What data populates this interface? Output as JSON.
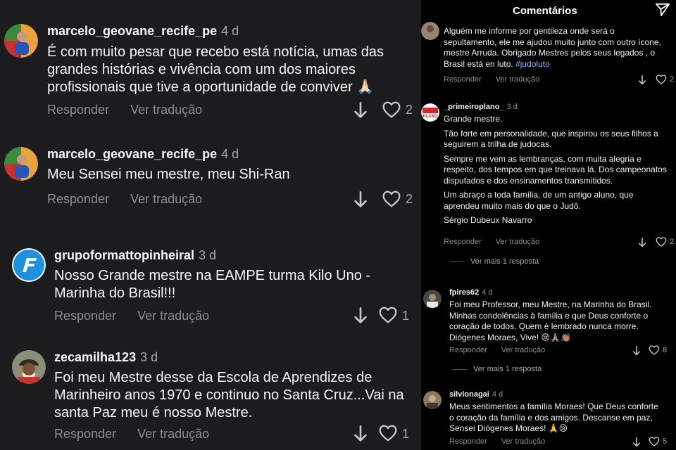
{
  "left": {
    "comments": [
      {
        "user": "marcelo_geovane_recife_pe",
        "time": "4 d",
        "text": "É com muito pesar que recebo está notícia, umas das grandes histórias e vivência com um dos maiores profissionais que tive a oportunidade de conviver 🙏🏻",
        "reply": "Responder",
        "translate": "Ver tradução",
        "likes": "2"
      },
      {
        "user": "marcelo_geovane_recife_pe",
        "time": "4 d",
        "text": "Meu Sensei meu mestre, meu Shi-Ran",
        "reply": "Responder",
        "translate": "Ver tradução",
        "likes": "2"
      },
      {
        "user": "grupoformattopinheiral",
        "time": "3 d",
        "text": "Nosso Grande mestre na EAMPE turma Kilo Uno - Marinha do Brasil!!!",
        "reply": "Responder",
        "translate": "Ver tradução",
        "likes": "1"
      },
      {
        "user": "zecamilha123",
        "time": "3 d",
        "text": "Foi meu Mestre desse da Escola de Aprendizes de Marinheiro anos 1970 e continuo no Santa Cruz...Vai na santa Paz meu é nosso Mestre.",
        "reply": "Responder",
        "translate": "Ver tradução",
        "likes": "1"
      }
    ]
  },
  "right": {
    "title": "Comentários",
    "comments": [
      {
        "text": "Alguém me informe por gentileza onde será o sepultamento,  ele me ajudou muito junto com outro ícone,  mestre Arruda. Obrigado Mestres pelos seus legados , o Brasil está en luto.",
        "hashtag": "#judoluto",
        "reply": "Responder",
        "translate": "Ver tradução",
        "likes": "2"
      },
      {
        "user": "_primeiroplano_",
        "time": "3 d",
        "avatar_text": "PLANO",
        "paragraphs": [
          "Grande mestre.",
          "Tão forte em personalidade, que inspirou os seus filhos a seguirem a trilha de judocas.",
          "Sempre me vem as lembranças, com muita alegria e respeito, dos tempos em que treinava lá. Dos campeonatos disputados e dos ensinamentos transmitidos.",
          "Um abraço a toda família, de um antigo aluno, que aprendeu muito mais do que o Judô.",
          "Sérgio Dubeux Navarro"
        ],
        "reply": "Responder",
        "translate": "Ver tradução",
        "likes": "2",
        "more_replies": "Ver mais 1 resposta"
      },
      {
        "user": "fpires62",
        "time": "4 d",
        "text": "Foi meu Professor, meu Mestre, na Marinha do Brasil. Minhas condolências à família e que Deus conforte o coração de todos. Quem é lembrado nunca morre. Diógenes Moraes, Vive! 😢🙏🏽👏🏽",
        "reply": "Responder",
        "translate": "Ver tradução",
        "likes": "8",
        "more_replies": "Ver mais 1 resposta"
      },
      {
        "user": "silvionagai",
        "time": "4 d",
        "text": "Meus sentimentos a família Moraes! Que Deus conforte  o coração da família e dos amigos. Descanse em paz, Sensei Diógenes Moraes! 🙏😢",
        "reply": "Responder",
        "translate": "Ver tradução",
        "likes": "5"
      }
    ]
  },
  "colors": {
    "left_bg": "#1c1c1e",
    "right_bg": "#000000",
    "muted": "#8e8e8e",
    "hashtag": "#8ab4f8"
  },
  "icons": [
    "heart-icon",
    "down-arrow-icon",
    "send-icon"
  ]
}
